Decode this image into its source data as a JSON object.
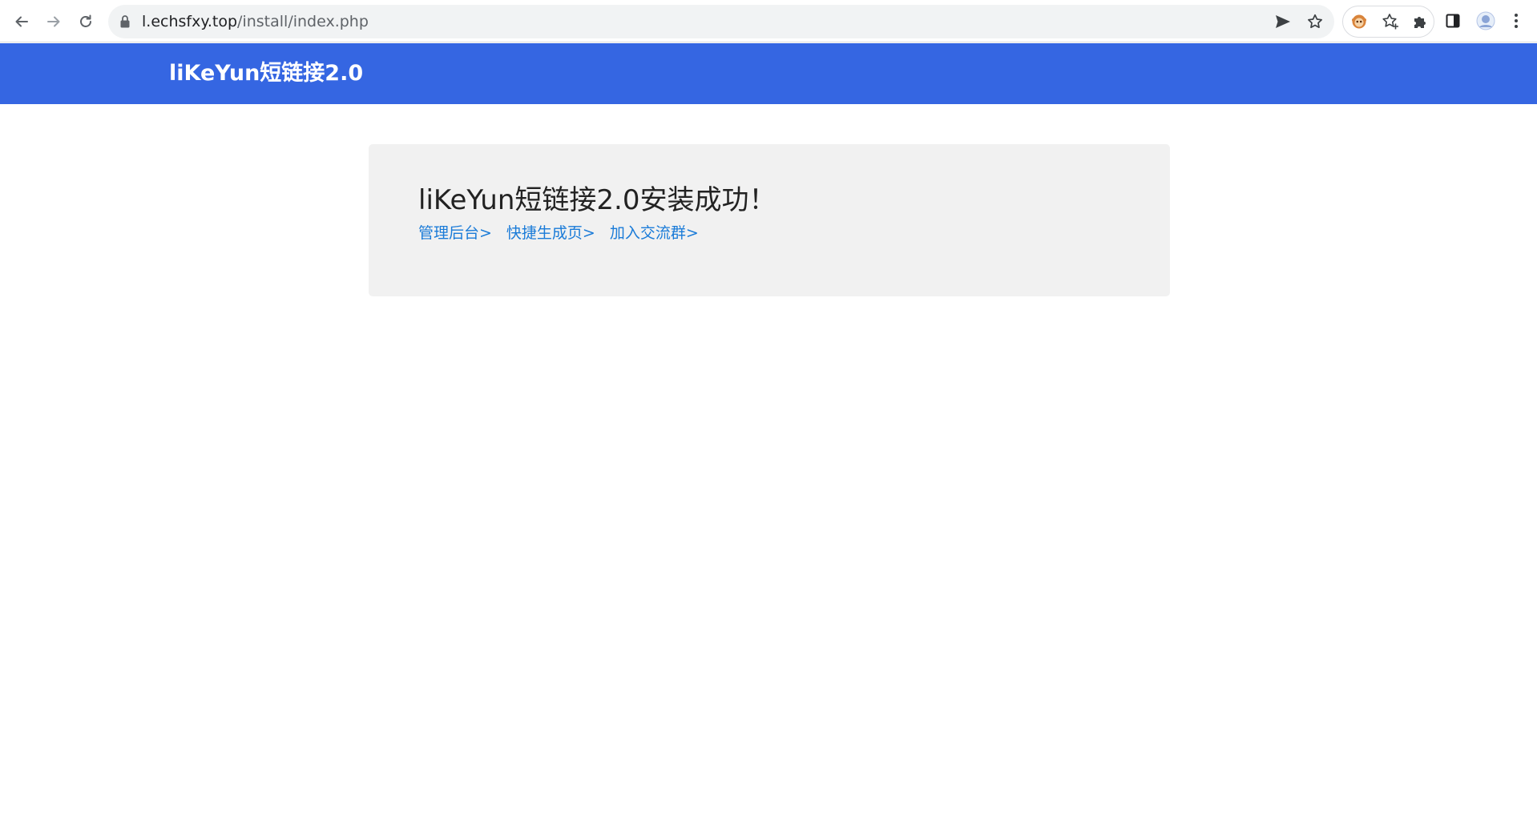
{
  "browser": {
    "url_host": "l.echsfxy.top",
    "url_path": "/install/index.php",
    "nav_icons": [
      "back-arrow-icon",
      "forward-arrow-icon",
      "reload-icon"
    ],
    "omnibox_icons": [
      "lock-icon",
      "send-tab-icon",
      "bookmark-star-icon"
    ],
    "toolbar_icons": [
      "tampermonkey-extension-icon",
      "bookmark-manager-icon",
      "extensions-puzzle-icon",
      "side-panel-icon",
      "profile-avatar-icon",
      "kebab-menu-icon"
    ]
  },
  "header": {
    "brand": "liKeYun短链接2.0",
    "background_color": "#3566e2"
  },
  "main": {
    "title": "liKeYun短链接2.0安装成功！",
    "links": [
      {
        "label": "管理后台>"
      },
      {
        "label": "快捷生成页>"
      },
      {
        "label": "加入交流群>"
      }
    ],
    "link_color": "#1a7bd8",
    "panel_color": "#f1f1f1"
  }
}
